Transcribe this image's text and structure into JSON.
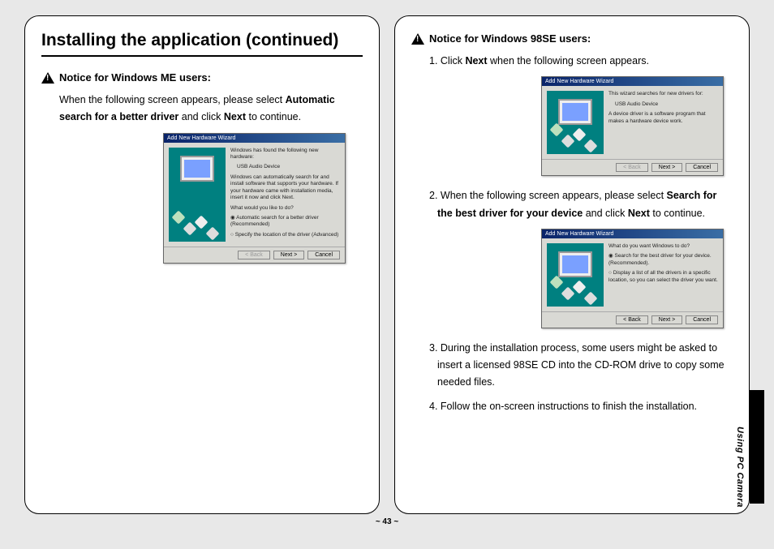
{
  "page": {
    "title": "Installing the application (continued)",
    "number": "~ 43 ~",
    "side_label": "Using PC Camera"
  },
  "left": {
    "notice_heading": "Notice for Windows ME users:",
    "para_pre": "When the following screen appears, please select ",
    "para_bold1": "Automatic search for a better driver",
    "para_mid": " and click ",
    "para_bold2": "Next",
    "para_post": " to continue."
  },
  "wizardME": {
    "title": "Add New Hardware Wizard",
    "line1": "Windows has found the following new hardware:",
    "line2": "USB Audio Device",
    "line3": "Windows can automatically search for and install software that supports your hardware. If your hardware came with installation media, insert it now and click Next.",
    "line4": "What would you like to do?",
    "opt1": "Automatic search for a better driver (Recommended)",
    "opt2": "Specify the location of the driver (Advanced)",
    "btn_back": "< Back",
    "btn_next": "Next >",
    "btn_cancel": "Cancel"
  },
  "right": {
    "notice_heading": "Notice for Windows 98SE users:",
    "step1_pre": "1. Click ",
    "step1_bold": "Next",
    "step1_post": " when the following screen appears.",
    "step2_pre": "2. When the following screen appears, please select ",
    "step2_bold1": "Search for the best driver for your device",
    "step2_mid": " and click ",
    "step2_bold2": "Next",
    "step2_post": " to continue.",
    "step3": "3. During the installation process, some users might be asked to insert a licensed 98SE CD into the CD-ROM drive to copy some needed files.",
    "step4": "4. Follow the on-screen instructions to finish the installation."
  },
  "wizard98a": {
    "title": "Add New Hardware Wizard",
    "line1": "This wizard searches for new drivers for:",
    "line2": "USB Audio Device",
    "line3": "A device driver is a software program that makes a hardware device work.",
    "btn_back": "< Back",
    "btn_next": "Next >",
    "btn_cancel": "Cancel"
  },
  "wizard98b": {
    "title": "Add New Hardware Wizard",
    "line1": "What do you want Windows to do?",
    "opt1": "Search for the best driver for your device. (Recommended).",
    "opt2": "Display a list of all the drivers in a specific location, so you can select the driver you want.",
    "btn_back": "< Back",
    "btn_next": "Next >",
    "btn_cancel": "Cancel"
  }
}
